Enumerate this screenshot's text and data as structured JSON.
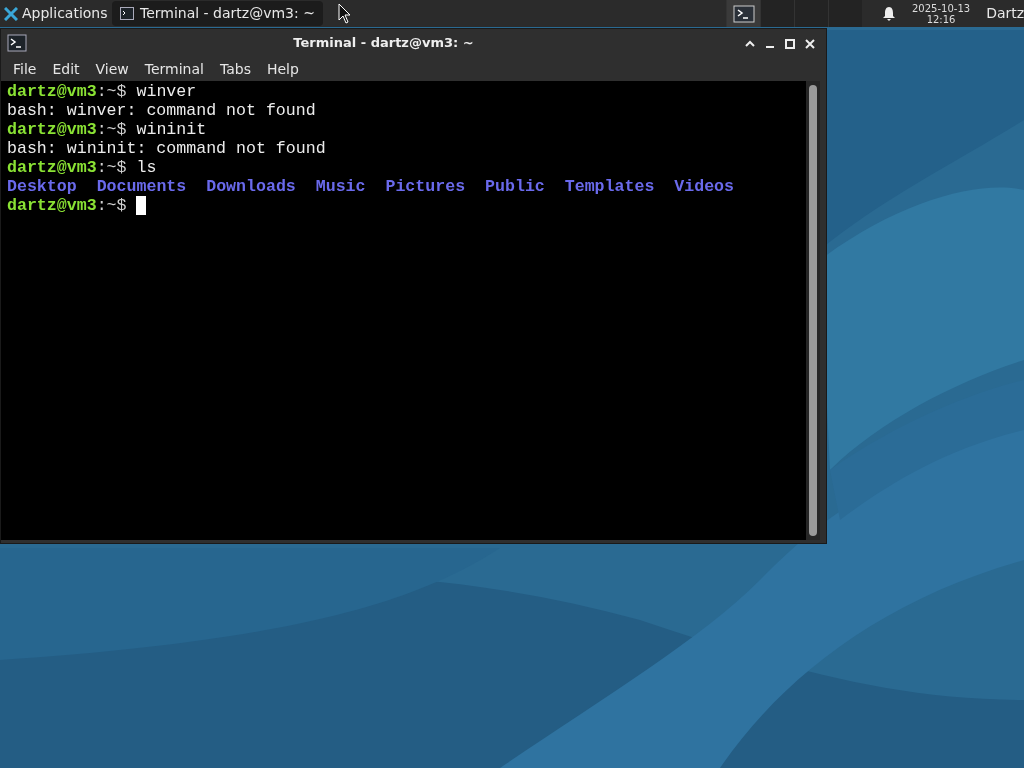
{
  "panel": {
    "applications": "Applications",
    "tasks": [
      {
        "label": "Terminal - dartz@vm3: ~",
        "selected": true
      }
    ],
    "workspaces": [
      {
        "selected": true
      },
      {
        "selected": false
      },
      {
        "selected": false
      },
      {
        "selected": false
      }
    ],
    "clock": {
      "date": "2025-10-13",
      "time": "12:16"
    },
    "user": "Dartz"
  },
  "window": {
    "title": "Terminal - dartz@vm3: ~",
    "menu": [
      "File",
      "Edit",
      "View",
      "Terminal",
      "Tabs",
      "Help"
    ],
    "lines": [
      {
        "kind": "prompt",
        "user": "dartz@vm3",
        "path": ":~$",
        "command": "winver"
      },
      {
        "kind": "output",
        "text": "bash: winver: command not found"
      },
      {
        "kind": "prompt",
        "user": "dartz@vm3",
        "path": ":~$",
        "command": "wininit"
      },
      {
        "kind": "output",
        "text": "bash: wininit: command not found"
      },
      {
        "kind": "prompt",
        "user": "dartz@vm3",
        "path": ":~$",
        "command": "ls"
      },
      {
        "kind": "listing",
        "items": [
          "Desktop",
          "Documents",
          "Downloads",
          "Music",
          "Pictures",
          "Public",
          "Templates",
          "Videos"
        ]
      },
      {
        "kind": "prompt",
        "user": "dartz@vm3",
        "path": ":~$",
        "cursor": true
      }
    ]
  }
}
